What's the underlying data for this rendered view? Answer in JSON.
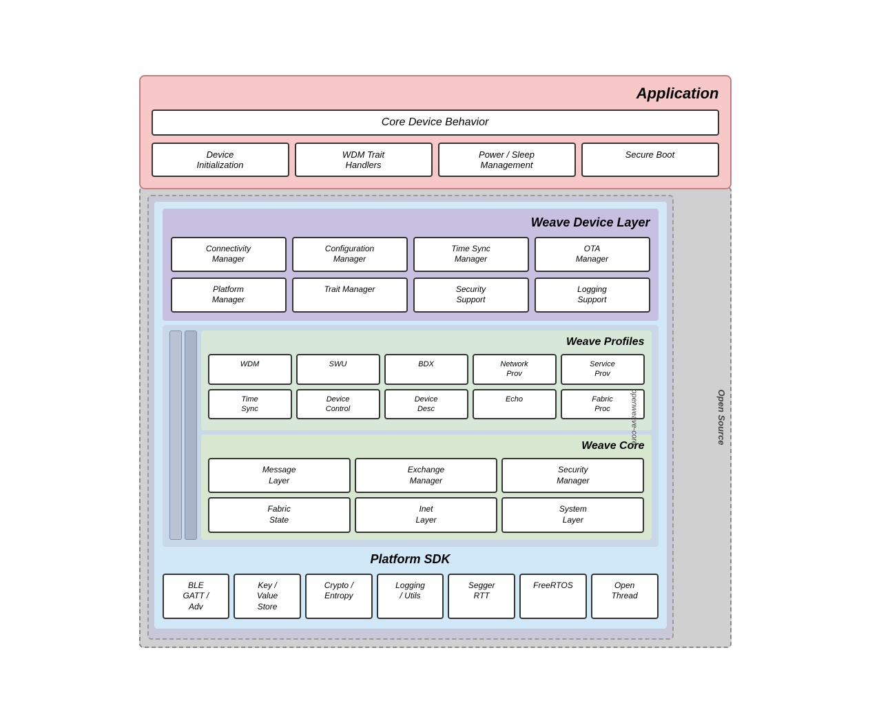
{
  "app": {
    "title": "Application",
    "coreDeviceBehavior": "Core Device Behavior",
    "subBoxes": [
      "Device\nInitialization",
      "WDM Trait\nHandlers",
      "Power / Sleep\nManagement",
      "Secure Boot"
    ]
  },
  "openSourceLabel": "Open Source",
  "openweaveLabel": "openweave-core",
  "platformSDK": {
    "title": "Platform SDK",
    "boxes": [
      "BLE\nGATT /\nAdv",
      "Key /\nValue\nStore",
      "Crypto /\nEntropy",
      "Logging\n/ Utils",
      "Segger\nRTT",
      "FreeRTOS",
      "Open\nThread"
    ]
  },
  "weaveDeviceLayer": {
    "title": "Weave Device Layer",
    "boxes": [
      "Connectivity\nManager",
      "Configuration\nManager",
      "Time Sync\nManager",
      "OTA\nManager",
      "Platform\nManager",
      "Trait Manager",
      "Security\nSupport",
      "Logging\nSupport"
    ]
  },
  "weaveProfiles": {
    "title": "Weave Profiles",
    "row1": [
      "WDM",
      "SWU",
      "BDX",
      "Network\nProv",
      "Service\nProv"
    ],
    "row2": [
      "Time\nSync",
      "Device\nControl",
      "Device\nDesc",
      "Echo",
      "Fabric\nProc"
    ]
  },
  "weaveCore": {
    "title": "Weave Core",
    "boxes": [
      "Message\nLayer",
      "Exchange\nManager",
      "Security\nManager",
      "Fabric\nState",
      "Inet\nLayer",
      "System\nLayer"
    ]
  }
}
